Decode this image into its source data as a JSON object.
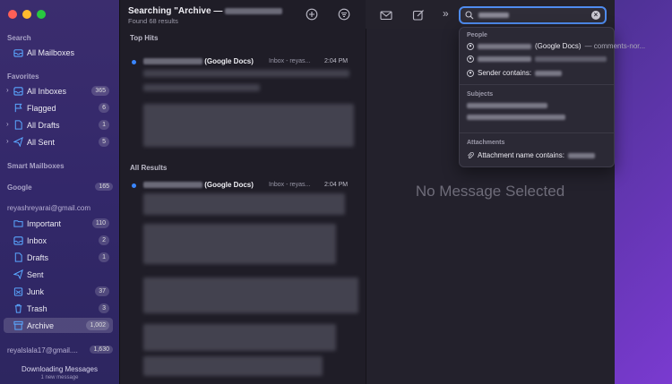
{
  "sidebar": {
    "search_header": "Search",
    "all_mailboxes": "All Mailboxes",
    "favorites_header": "Favorites",
    "favorites": [
      {
        "label": "All Inboxes",
        "count": "365"
      },
      {
        "label": "Flagged",
        "count": "6"
      },
      {
        "label": "All Drafts",
        "count": "1"
      },
      {
        "label": "All Sent",
        "count": "5"
      }
    ],
    "smart_header": "Smart Mailboxes",
    "google_header": "Google",
    "google_count": "165",
    "account_email": "reyashreyarai@gmail.com",
    "mailboxes": [
      {
        "label": "Important",
        "count": "110"
      },
      {
        "label": "Inbox",
        "count": "2"
      },
      {
        "label": "Drafts",
        "count": "1"
      },
      {
        "label": "Sent",
        "count": ""
      },
      {
        "label": "Junk",
        "count": "37"
      },
      {
        "label": "Trash",
        "count": "3"
      },
      {
        "label": "Archive",
        "count": "1,002"
      }
    ],
    "account2": "reyalslala17@gmail....",
    "account2_count": "1,630",
    "status": "Downloading Messages",
    "status_sub": "1 new message"
  },
  "list": {
    "title": "Searching \"Archive —",
    "found": "Found 68 results",
    "top_hits": "Top Hits",
    "all_results": "All Results",
    "hit1": {
      "sender": "(Google Docs)",
      "mailbox": "Inbox - reyas...",
      "time": "2:04 PM"
    },
    "hit2": {
      "sender": "(Google Docs)",
      "mailbox": "Inbox - reyas...",
      "time": "2:04 PM"
    }
  },
  "viewer": {
    "empty": "No Message Selected"
  },
  "dropdown": {
    "people_header": "People",
    "p1_tag": "(Google Docs)",
    "p1_rest": "— comments-nor...",
    "p3": "Sender contains:",
    "subjects_header": "Subjects",
    "attachments_header": "Attachments",
    "a1": "Attachment name contains:"
  }
}
